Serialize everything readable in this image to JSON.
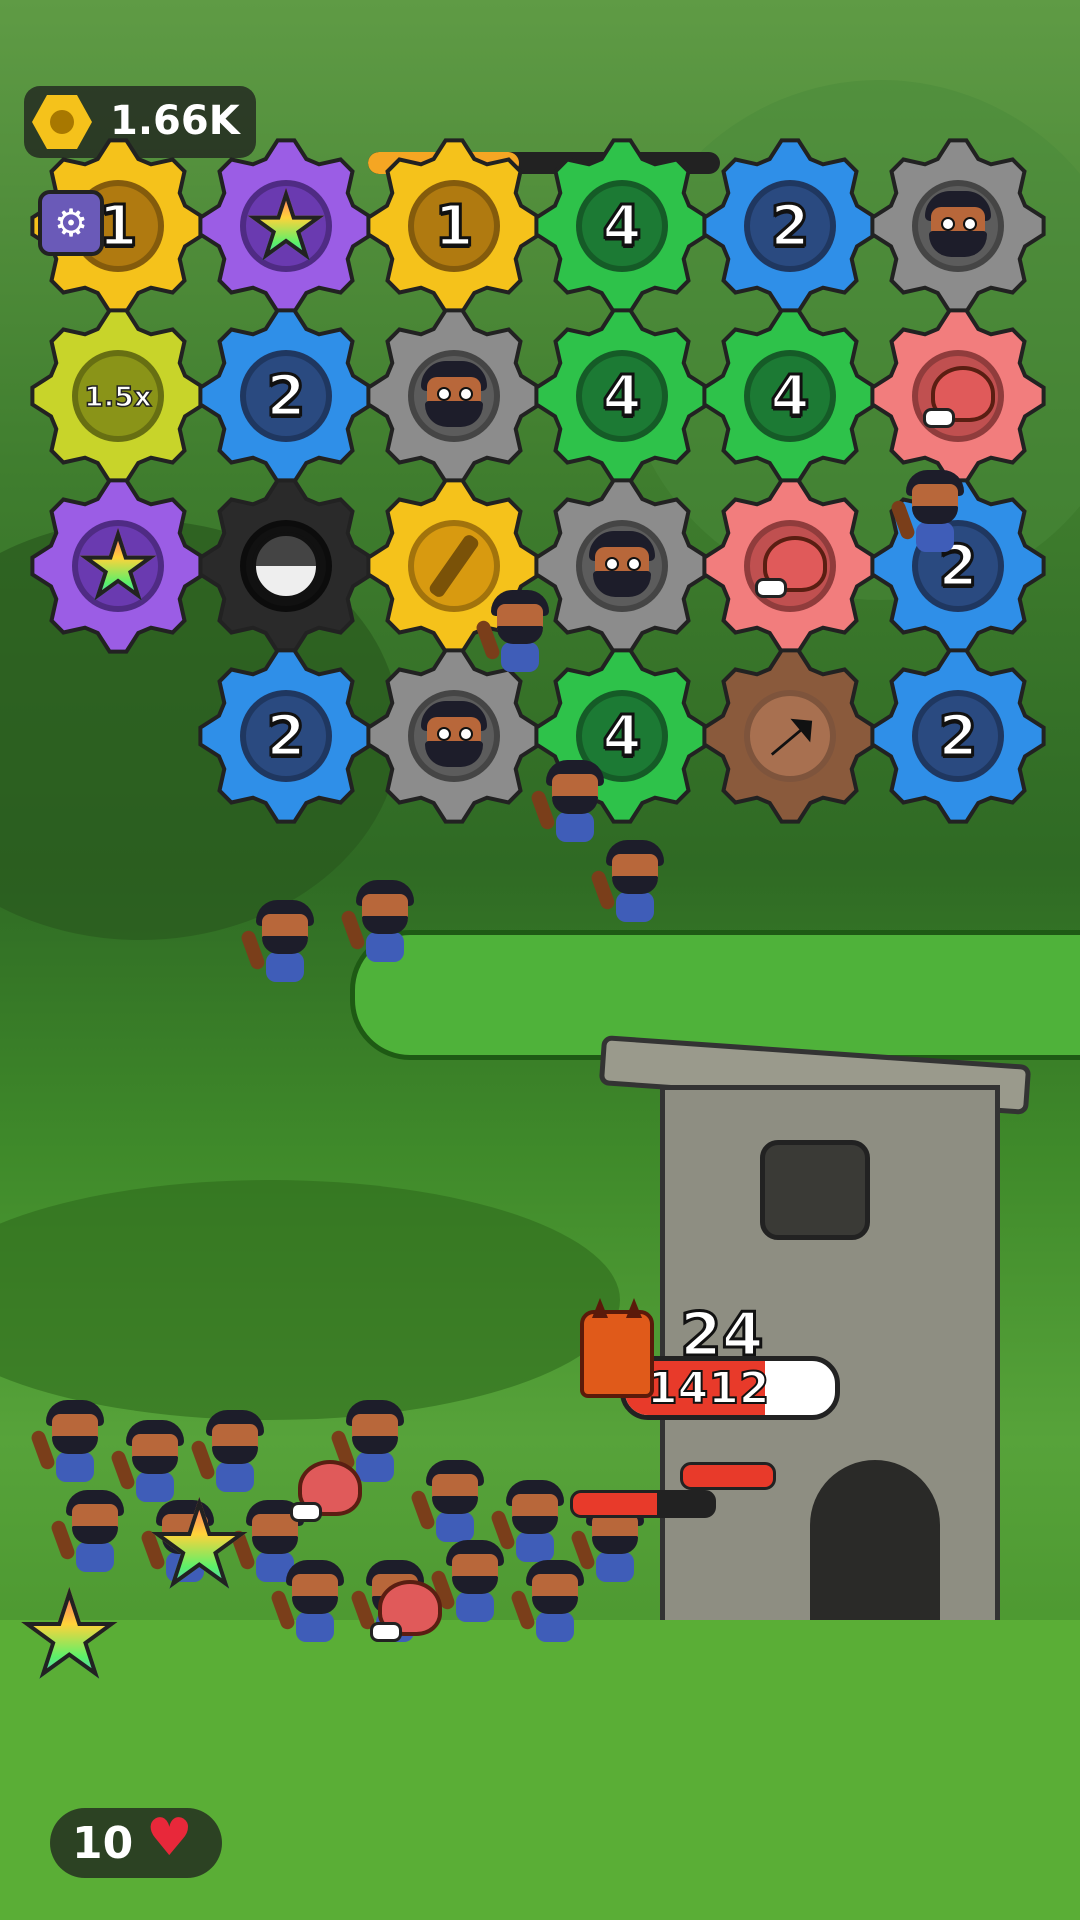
{
  "hud": {
    "coins": "1.66K",
    "coin_icon": "hex-coin-icon",
    "settings_icon": "gear-icon",
    "level_progress": 0.43,
    "lives_count": "10",
    "lives_icon": "heart-icon"
  },
  "colors": {
    "yellow": "#f5c21b",
    "purple": "#9b5de5",
    "green": "#2ec24a",
    "blue": "#2f8fe8",
    "gray": "#8c8c8c",
    "lime": "#c8d42a",
    "pink": "#f27d7d",
    "black": "#2a2a2a",
    "brown": "#8a5a3c",
    "hp_red": "#e83a2a"
  },
  "board": {
    "rows": [
      [
        {
          "type": "number",
          "color": "yellow",
          "label": "1"
        },
        {
          "type": "star",
          "color": "purple"
        },
        {
          "type": "number",
          "color": "yellow",
          "label": "1"
        },
        {
          "type": "number",
          "color": "green",
          "label": "4"
        },
        {
          "type": "number",
          "color": "blue",
          "label": "2"
        },
        {
          "type": "caveman",
          "color": "gray"
        }
      ],
      [
        {
          "type": "multiplier",
          "color": "lime",
          "label": "1.5x"
        },
        {
          "type": "number",
          "color": "blue",
          "label": "2"
        },
        {
          "type": "caveman",
          "color": "gray"
        },
        {
          "type": "number",
          "color": "green",
          "label": "4"
        },
        {
          "type": "number",
          "color": "green",
          "label": "4"
        },
        {
          "type": "meat",
          "color": "pink"
        }
      ],
      [
        {
          "type": "star",
          "color": "purple"
        },
        {
          "type": "bomb",
          "color": "black"
        },
        {
          "type": "coin",
          "color": "yellow"
        },
        {
          "type": "caveman",
          "color": "gray"
        },
        {
          "type": "meat",
          "color": "pink"
        },
        {
          "type": "number",
          "color": "blue",
          "label": "2"
        }
      ],
      [
        {
          "type": "empty"
        },
        {
          "type": "number",
          "color": "blue",
          "label": "2"
        },
        {
          "type": "caveman",
          "color": "gray"
        },
        {
          "type": "number",
          "color": "green",
          "label": "4"
        },
        {
          "type": "arrow",
          "color": "brown"
        },
        {
          "type": "number",
          "color": "blue",
          "label": "2"
        }
      ]
    ]
  },
  "battle": {
    "enemy_count": "24",
    "boss_hp": "1412",
    "boss_icon": "demon-boss-icon"
  }
}
